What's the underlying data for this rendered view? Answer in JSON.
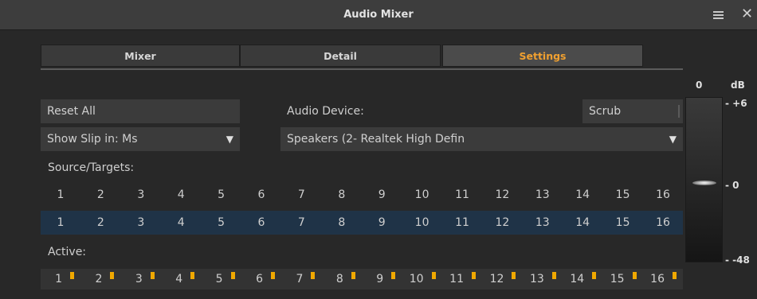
{
  "window": {
    "title": "Audio Mixer"
  },
  "tabs": [
    {
      "label": "Mixer",
      "active": false
    },
    {
      "label": "Detail",
      "active": false
    },
    {
      "label": "Settings",
      "active": true
    }
  ],
  "settings": {
    "reset_all": "Reset All",
    "show_slip": "Show Slip in: Ms",
    "audio_device_label": "Audio Device:",
    "audio_device_value": "Speakers (2- Realtek High Defin",
    "scrub": "Scrub",
    "source_targets_label": "Source/Targets:",
    "active_label": "Active:",
    "columns": [
      "1",
      "2",
      "3",
      "4",
      "5",
      "6",
      "7",
      "8",
      "9",
      "10",
      "11",
      "12",
      "13",
      "14",
      "15",
      "16"
    ],
    "targets": [
      "1",
      "2",
      "3",
      "4",
      "5",
      "6",
      "7",
      "8",
      "9",
      "10",
      "11",
      "12",
      "13",
      "14",
      "15",
      "16"
    ],
    "active": [
      "1",
      "2",
      "3",
      "4",
      "5",
      "6",
      "7",
      "8",
      "9",
      "10",
      "11",
      "12",
      "13",
      "14",
      "15",
      "16"
    ]
  },
  "meter": {
    "head_value": "0",
    "unit": "dB",
    "ticks": [
      "- +6",
      "- 0",
      "- -48"
    ]
  },
  "colors": {
    "accent": "#f0a030",
    "target_row": "#1f3347",
    "active_indicator": "#f0a800"
  }
}
